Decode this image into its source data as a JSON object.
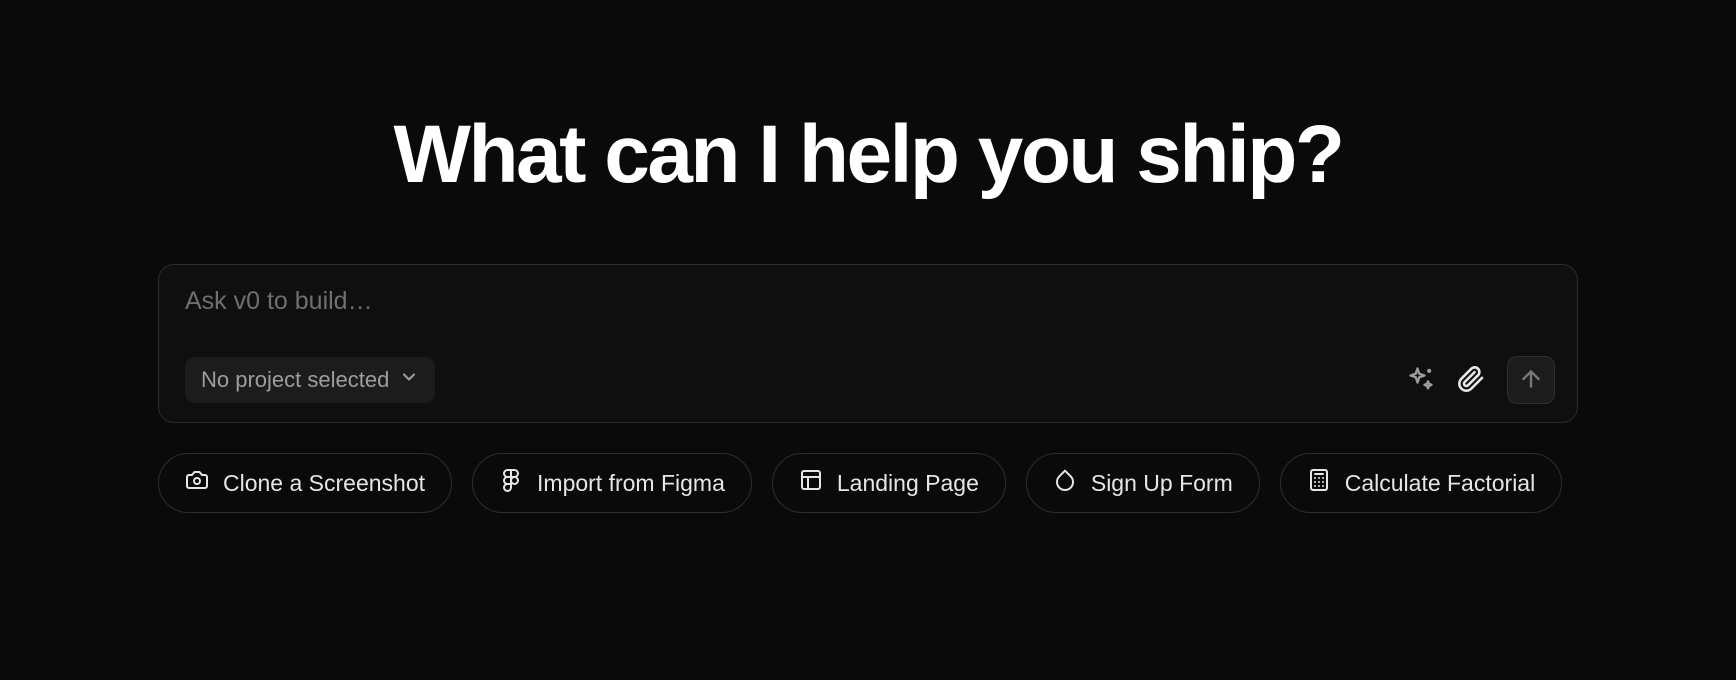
{
  "heading": "What can I help you ship?",
  "prompt": {
    "placeholder": "Ask v0 to build…",
    "value": "",
    "project_selector_label": "No project selected"
  },
  "suggestions": [
    {
      "id": "clone-screenshot",
      "label": "Clone a Screenshot",
      "icon": "camera-icon"
    },
    {
      "id": "import-figma",
      "label": "Import from Figma",
      "icon": "figma-icon"
    },
    {
      "id": "landing-page",
      "label": "Landing Page",
      "icon": "layout-icon"
    },
    {
      "id": "sign-up-form",
      "label": "Sign Up Form",
      "icon": "droplet-icon"
    },
    {
      "id": "calculate-factorial",
      "label": "Calculate Factorial",
      "icon": "calculator-icon"
    }
  ]
}
